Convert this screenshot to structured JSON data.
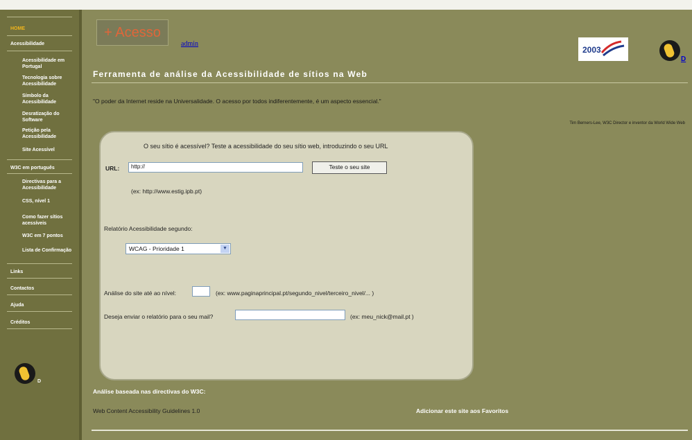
{
  "nav": {
    "home": "HOME",
    "acess": "Acessibilidade",
    "acess_items": [
      "Acessibilidade em Portugal",
      "Tecnologia sobre Acessibilidade",
      "Símbolo da Acessibilidade",
      "Desratização do Software",
      "Petição pela Acessibilidade",
      "Site Acessível"
    ],
    "w3c": "W3C em português",
    "w3c_items": [
      "Directivas para a Acessibilidade",
      "CSS, nível 1",
      "Como fazer sítios acessíveis",
      "W3C em 7 pontos",
      "Lista de Confirmação"
    ],
    "links": "Links",
    "contactos": "Contactos",
    "ajuda": "Ajuda",
    "creditos": "Créditos",
    "d_link": "D"
  },
  "header": {
    "acesso_button": "+ Acesso",
    "admin_link": "admin",
    "logo_text": "2003",
    "d_link": "D",
    "title": "Ferramenta de análise da Acessibilidade de sítios na Web"
  },
  "quote": {
    "text": "\"O poder da Internet reside na Universalidade. O acesso por todos indiferentemente, é um aspecto essencial.\"",
    "author": "Tim Berners-Lee, W3C Director e inventor da World Wide Web"
  },
  "form": {
    "intro": "O seu sítio é acessível? Teste a acessibilidade do seu sítio web, introduzindo o seu URL",
    "url_label": "URL:",
    "url_value": "http://",
    "submit_label": "Teste o seu site",
    "url_example": "(ex: http://www.estig.ipb.pt)",
    "report_label": "Relatório Acessibilidade segundo:",
    "report_selected": "WCAG - Prioridade 1",
    "level_label": "Análise do site até ao nível:",
    "level_value": "",
    "level_example": "(ex: www.paginaprincipal.pt/segundo_nivel/terceiro_nivel/... )",
    "email_label": "Deseja enviar o relatório para o seu mail?",
    "email_value": "",
    "email_example": "(ex: meu_nick@mail.pt )"
  },
  "footer": {
    "heading": "Análise baseada nas directivas do W3C:",
    "wcag": "Web Content Accessibility Guidelines 1.0",
    "favorites": "Adicionar este site aos Favoritos"
  },
  "colors": {
    "background": "#8a8a5a",
    "sidebar": "#70703f",
    "panel": "#d8d6bf",
    "home_link": "#f1b51c",
    "acesso_text": "#e0663a"
  }
}
